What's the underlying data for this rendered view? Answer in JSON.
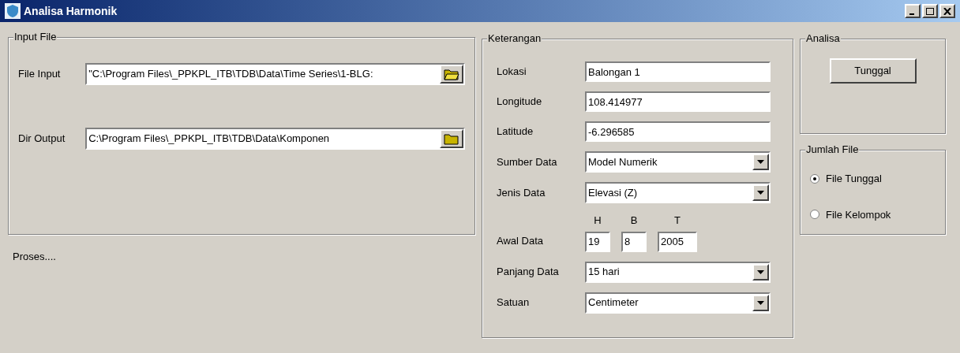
{
  "window": {
    "title": "Analisa Harmonik"
  },
  "input_file": {
    "title": "Input File",
    "fields": [
      {
        "label": "File Input",
        "value": "\"C:\\Program Files\\_PPKPL_ITB\\TDB\\Data\\Time Series\\1-BLG:"
      },
      {
        "label": "Dir Output",
        "value": "C:\\Program Files\\_PPKPL_ITB\\TDB\\Data\\Komponen"
      }
    ]
  },
  "status": "Proses....",
  "keterangan": {
    "title": "Keterangan",
    "fields": [
      {
        "kind": "text",
        "label": "Lokasi",
        "value": "Balongan 1"
      },
      {
        "kind": "text",
        "label": "Longitude",
        "value": "108.414977"
      },
      {
        "kind": "text",
        "label": "Latitude",
        "value": "-6.296585"
      },
      {
        "kind": "dropdown",
        "label": "Sumber Data",
        "value": "Model Numerik"
      },
      {
        "kind": "dropdown",
        "label": "Jenis Data",
        "value": "Elevasi (Z)"
      },
      {
        "kind": "date",
        "label": "Awal Data",
        "parts": [
          {
            "heading": "H",
            "value": "19"
          },
          {
            "heading": "B",
            "value": "8"
          },
          {
            "heading": "T",
            "value": "2005"
          }
        ]
      },
      {
        "kind": "dropdown",
        "label": "Panjang Data",
        "value": "15 hari"
      },
      {
        "kind": "dropdown",
        "label": "Satuan",
        "value": "Centimeter"
      }
    ]
  },
  "analisa": {
    "title": "Analisa",
    "button": "Tunggal"
  },
  "jumlah_file": {
    "title": "Jumlah File",
    "options": [
      {
        "label": "File Tunggal",
        "selected": true
      },
      {
        "label": "File Kelompok",
        "selected": false
      }
    ]
  }
}
